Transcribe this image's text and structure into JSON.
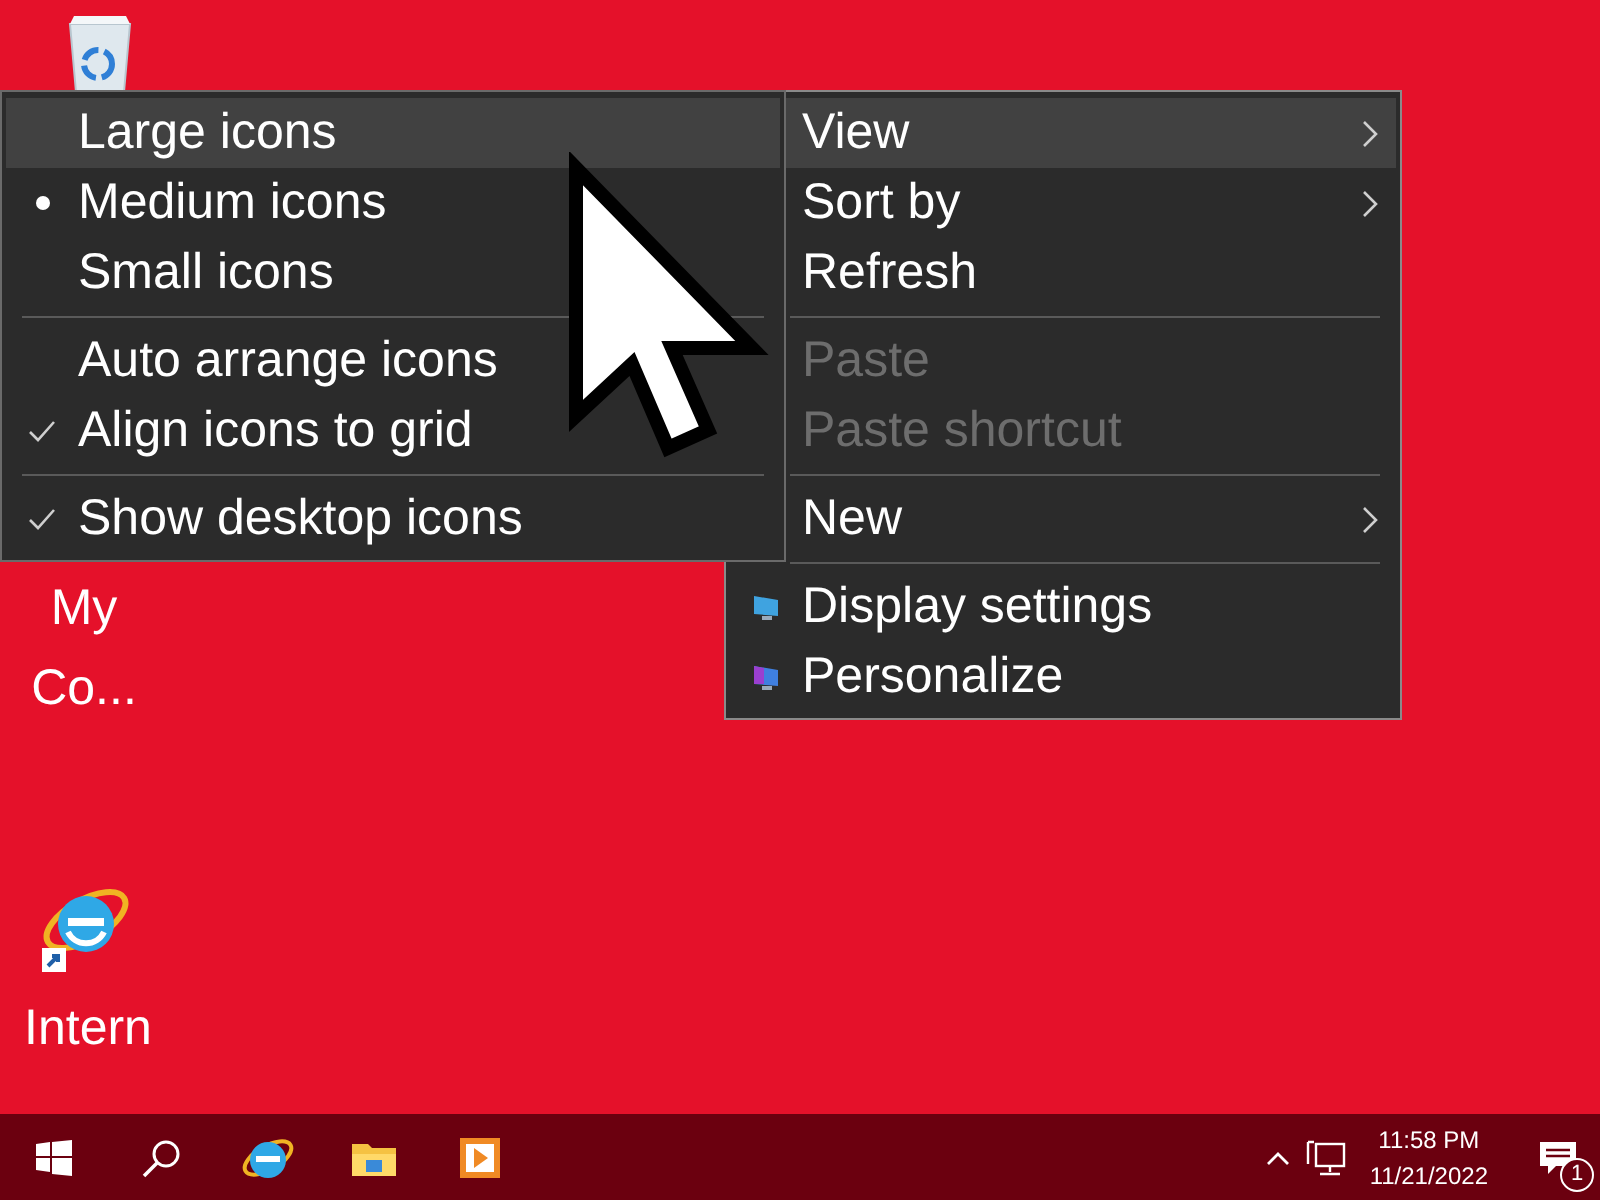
{
  "desktop_icons": [
    {
      "kind": "recycle-bin"
    },
    {
      "kind": "computer",
      "label": "My Co..."
    },
    {
      "kind": "internet-explorer",
      "label": "Intern"
    }
  ],
  "context_menu": {
    "items": [
      {
        "kind": "item",
        "label": "View",
        "highlighted": true,
        "disabled": false,
        "submenu": true
      },
      {
        "kind": "item",
        "label": "Sort by",
        "highlighted": false,
        "disabled": false,
        "submenu": true
      },
      {
        "kind": "item",
        "label": "Refresh",
        "highlighted": false,
        "disabled": false,
        "submenu": false
      },
      {
        "kind": "separator"
      },
      {
        "kind": "item",
        "label": "Paste",
        "highlighted": false,
        "disabled": true,
        "submenu": false
      },
      {
        "kind": "item",
        "label": "Paste shortcut",
        "highlighted": false,
        "disabled": true,
        "submenu": false
      },
      {
        "kind": "separator"
      },
      {
        "kind": "item",
        "label": "New",
        "highlighted": false,
        "disabled": false,
        "submenu": true
      },
      {
        "kind": "separator"
      },
      {
        "kind": "display",
        "label": "Display settings",
        "highlighted": false,
        "disabled": false,
        "submenu": false
      },
      {
        "kind": "personalize",
        "label": "Personalize",
        "highlighted": false,
        "disabled": false,
        "submenu": false
      }
    ]
  },
  "view_submenu": {
    "items": [
      {
        "kind": "radio",
        "label": "Large icons",
        "selected": false,
        "highlighted": true
      },
      {
        "kind": "radio",
        "label": "Medium icons",
        "selected": true,
        "highlighted": false
      },
      {
        "kind": "radio",
        "label": "Small icons",
        "selected": false,
        "highlighted": false
      },
      {
        "kind": "separator"
      },
      {
        "kind": "check",
        "label": "Auto arrange icons",
        "checked": false,
        "highlighted": false
      },
      {
        "kind": "check",
        "label": "Align icons to grid",
        "checked": true,
        "highlighted": false
      },
      {
        "kind": "separator"
      },
      {
        "kind": "check",
        "label": "Show desktop icons",
        "checked": true,
        "highlighted": false
      }
    ]
  },
  "taskbar": {
    "apps": [
      {
        "kind": "start"
      },
      {
        "kind": "search"
      },
      {
        "kind": "internet-explorer"
      },
      {
        "kind": "file-explorer"
      },
      {
        "kind": "media-player"
      }
    ],
    "tray": [
      {
        "kind": "chevron"
      },
      {
        "kind": "network"
      }
    ],
    "clock": {
      "time": "11:58 PM",
      "date": "11/21/2022"
    },
    "notifications": {
      "count": "1"
    }
  }
}
